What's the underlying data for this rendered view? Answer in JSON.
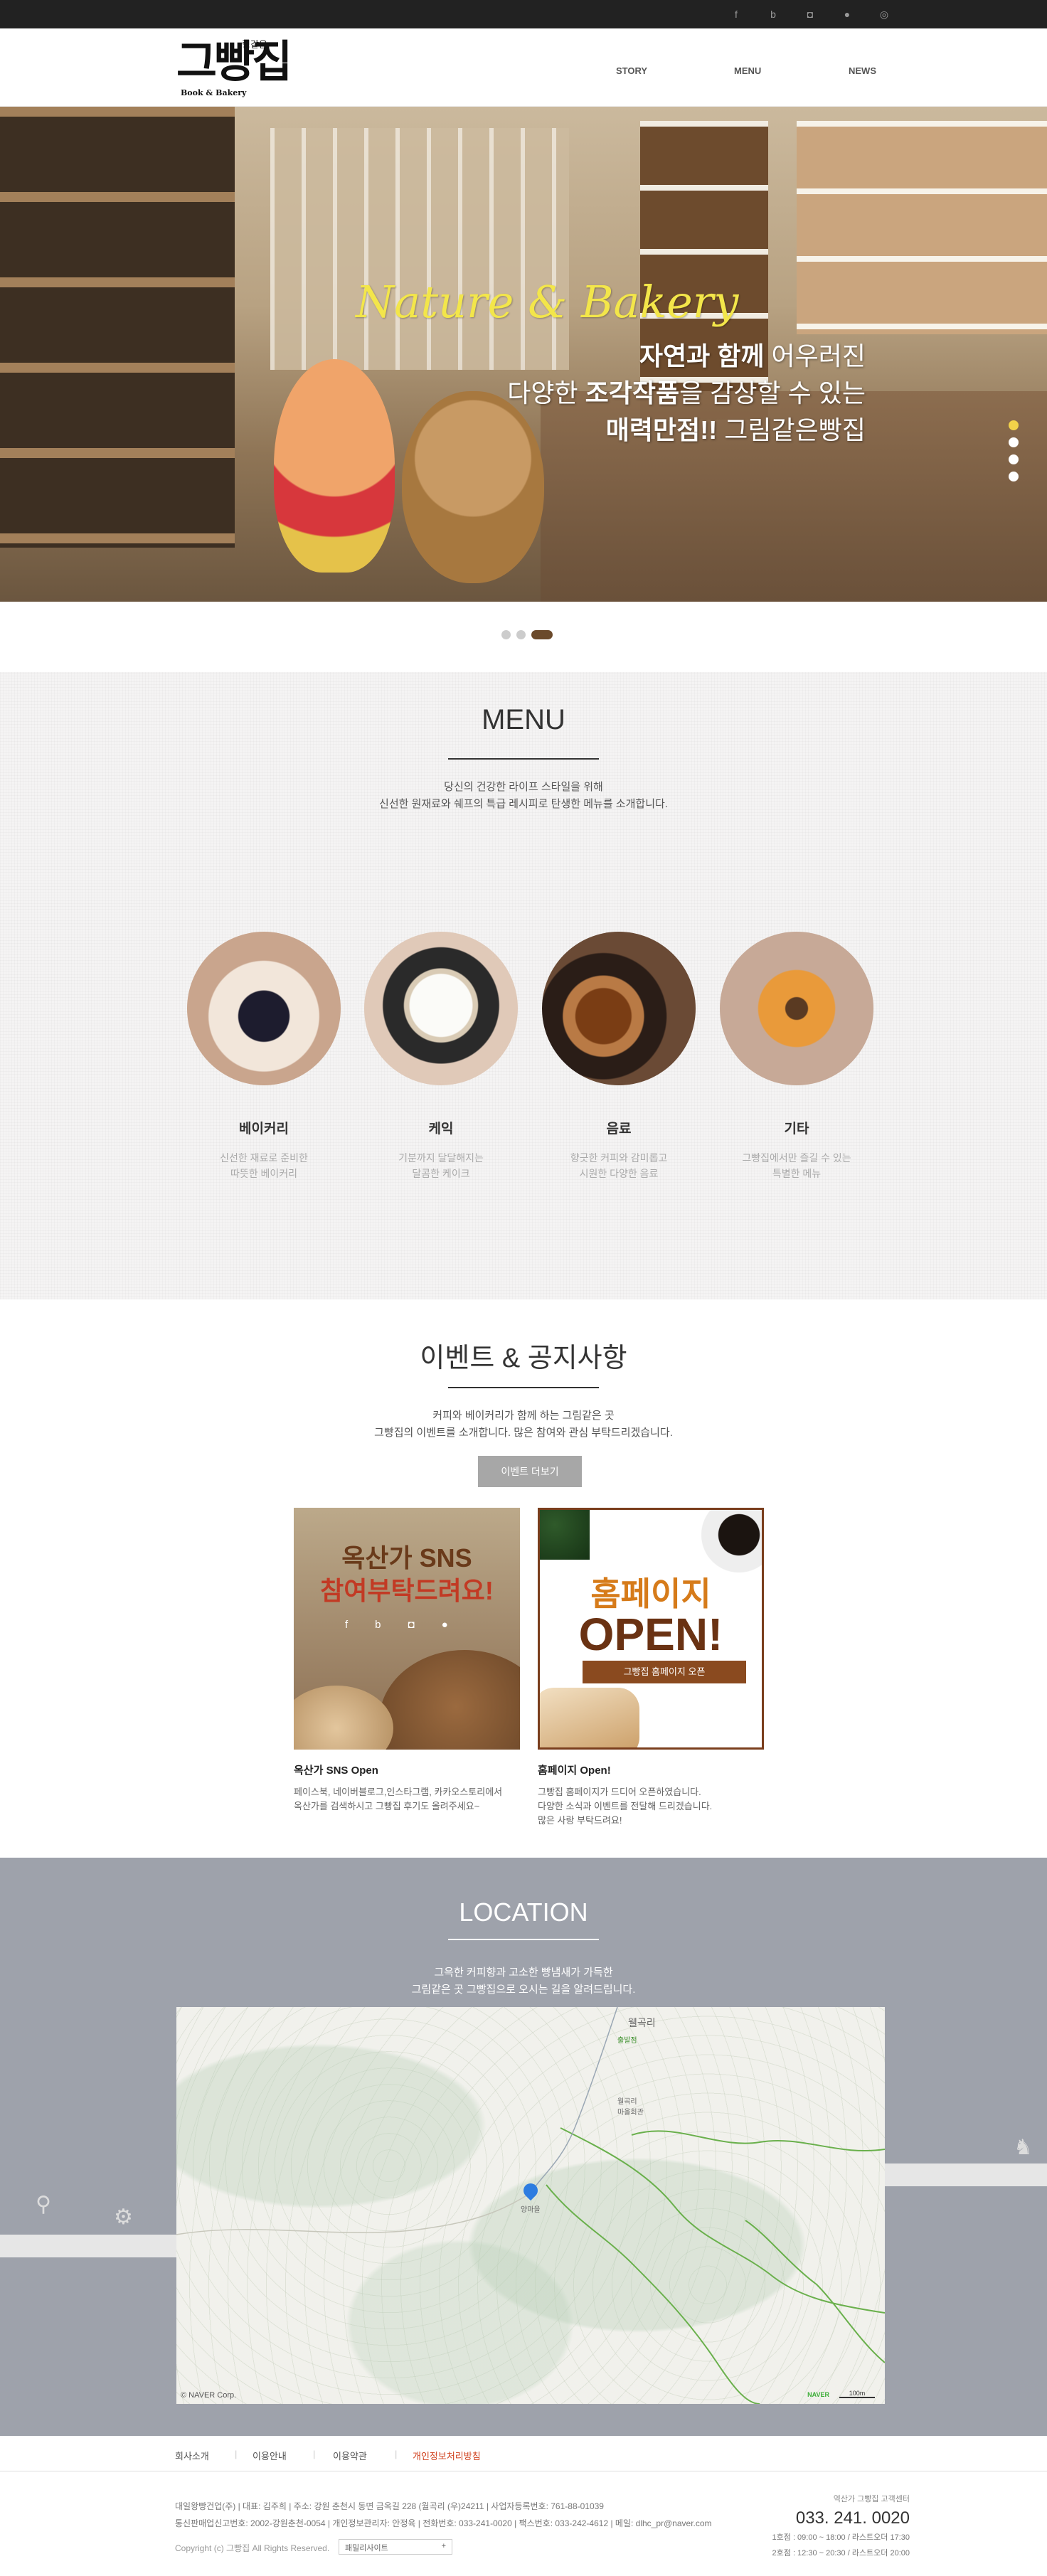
{
  "social": {
    "icons": [
      "facebook-icon",
      "blog-icon",
      "instagram-icon",
      "talk-icon",
      "location-icon"
    ],
    "glyphs": [
      "f",
      "b",
      "◘",
      "●",
      "◎"
    ]
  },
  "logo": {
    "small": "림같은",
    "big": "그빵집",
    "sub": "Book & Bakery"
  },
  "nav": {
    "story": "STORY",
    "menu": "MENU",
    "news": "NEWS"
  },
  "hero": {
    "title": "Nature & Bakery",
    "line1_bold": "자연과 함께",
    "line1_light": " 어우러진",
    "line2_light": "다양한 ",
    "line2_bold": "조각작품",
    "line2_light2": "을 감상할 수 있는",
    "line3_bold": "매력만점!!",
    "line3_light": " 그림같은빵집"
  },
  "menu": {
    "title": "MENU",
    "desc1": "당신의 건강한 라이프 스타일을 위해",
    "desc2": "신선한 원재료와 쉐프의 특급 레시피로 탄생한 메뉴를 소개합니다.",
    "items": [
      {
        "name": "베이커리",
        "desc1": "신선한 재료로 준비한",
        "desc2": "따뜻한 베이커리"
      },
      {
        "name": "케익",
        "desc1": "기분까지 달달해지는",
        "desc2": "달콤한 케이크"
      },
      {
        "name": "음료",
        "desc1": "향긋한 커피와 감미롭고",
        "desc2": "시원한 다양한 음료"
      },
      {
        "name": "기타",
        "desc1": "그빵집에서만 즐길 수 있는",
        "desc2": "특별한 메뉴"
      }
    ]
  },
  "events": {
    "title": "이벤트 & 공지사항",
    "desc1": "커피와 베이커리가 함께 하는 그림같은 곳",
    "desc2": "그빵집의 이벤트를 소개합니다. 많은 참여와 관심 부탁드리겠습니다.",
    "more_button": "이벤트 더보기",
    "card1": {
      "line1": "옥산가 SNS",
      "line2": "참여부탁드려요!"
    },
    "card2": {
      "line1": "홈페이지",
      "line2": "OPEN!",
      "ribbon": "그빵집 홈페이지 오픈"
    },
    "caption1": {
      "title": "옥산가 SNS Open",
      "l1": "페이스북, 네이버블로그,인스타그램, 카카오스토리에서",
      "l2": "옥산가를 검색하시고 그빵집 후기도 올려주세요~"
    },
    "caption2": {
      "title": "홈페이지 Open!",
      "l1": "그빵집 홈페이지가 드디어 오픈하였습니다.",
      "l2": "다양한 소식과 이벤트를 전달해 드리겠습니다.",
      "l3": "많은 사랑 부탁드려요!"
    }
  },
  "location": {
    "title": "LOCATION",
    "desc1": "그윽한 커피향과 고소한 빵냄새가 가득한",
    "desc2": "그림같은 곳 그빵집으로 오시는 길을 알려드립니다.",
    "map_labels": {
      "top": "웰곡리",
      "station": "출발점",
      "mid": "월곡리\n마을회관",
      "pin": "양마을"
    },
    "copyright": "© NAVER Corp.",
    "naver": "NAVER",
    "scale": "100m"
  },
  "footer": {
    "links": [
      "회사소개",
      "이용안내",
      "이용약관",
      "개인정보처리방침"
    ],
    "info1": "대일왕빵건업(주)  |  대표: 김주희  |  주소: 강원 춘천시 동면 금옥길 228 (월곡리 (우)24211  |  사업자등록번호: 761-88-01039",
    "info2": "통신판매업신고번호: 2002-강원춘천-0054  |  개인정보관리자: 안정육  |  전화번호: 033-241-0020  |  팩스번호: 033-242-4612  |  메일: dlhc_pr@naver.com",
    "copy": "Copyright (c) 그빵집 All Rights Reserved.",
    "family_site": "패밀리사이트",
    "right_small": "역산가 그빵집 고객센터",
    "tel": "033. 241. 0020",
    "hours1": "1호점 : 09:00 ~ 18:00 / 라스트오더 17:30",
    "hours2": "2호점 : 12:30 ~ 20:30 / 라스트오더 20:00"
  }
}
